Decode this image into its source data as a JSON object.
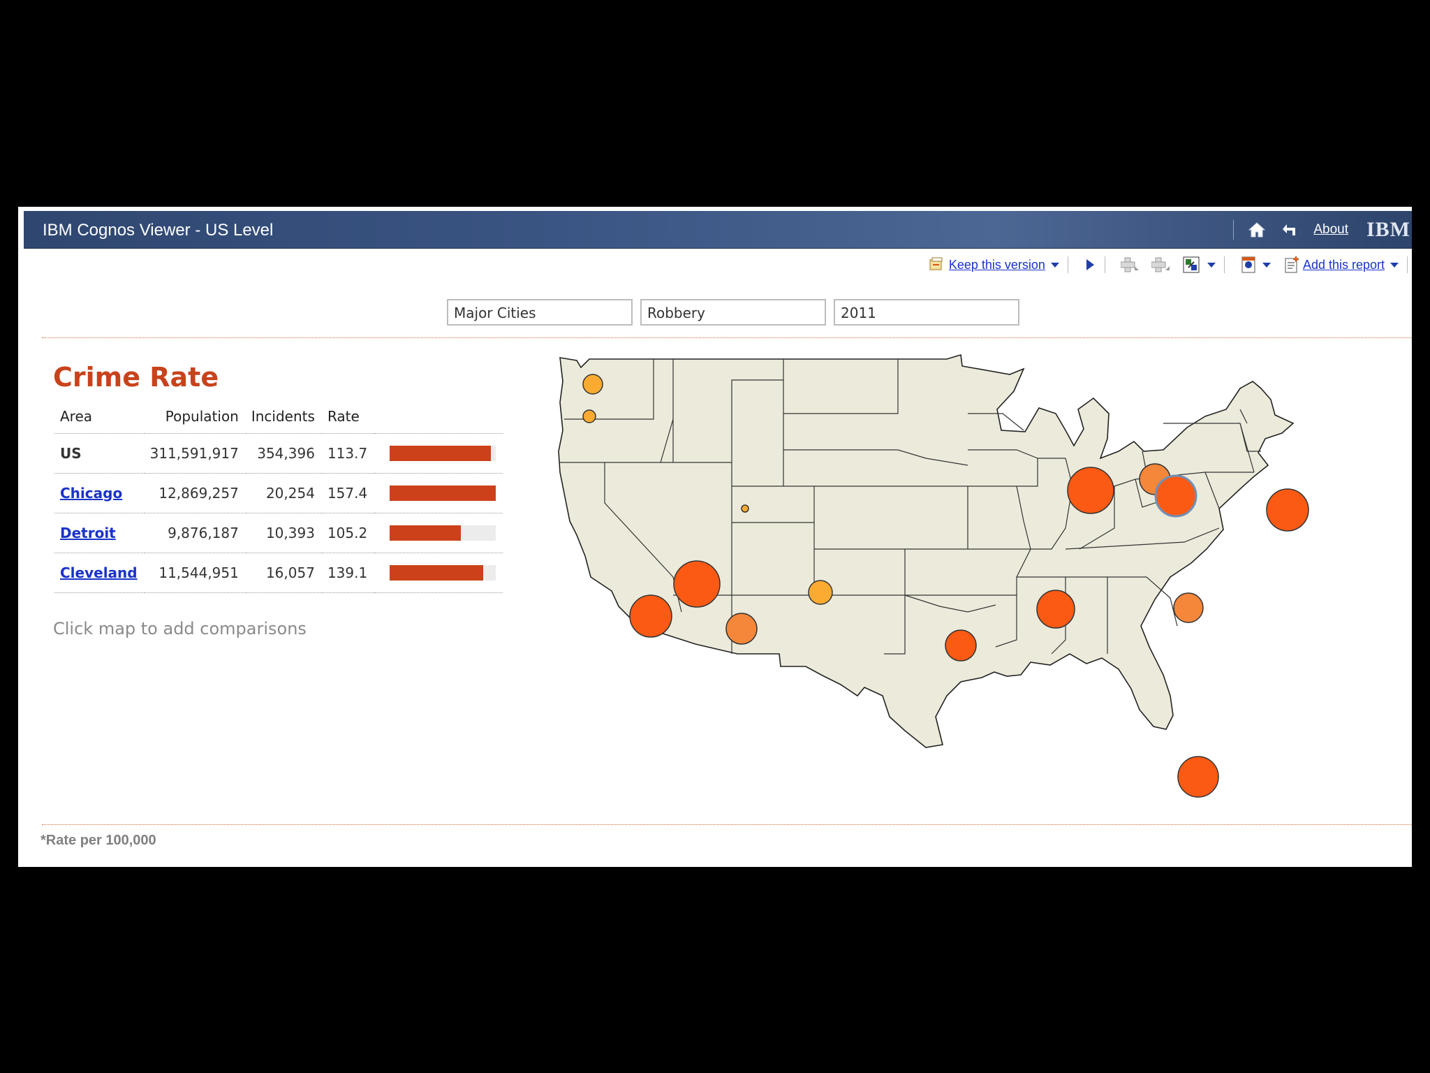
{
  "window": {
    "title": "IBM Cognos Viewer - US Level",
    "about_label": "About",
    "brand": "IBM"
  },
  "toolbar": {
    "keep_version_label": "Keep this version",
    "add_report_label": "Add this report"
  },
  "prompts": {
    "area": "Major Cities",
    "crime": "Robbery",
    "year": "2011"
  },
  "report": {
    "title": "Crime Rate",
    "columns": [
      "Area",
      "Population",
      "Incidents",
      "Rate"
    ],
    "rows": [
      {
        "area": "US",
        "population": "311,591,917",
        "incidents": "354,396",
        "rate": "113.7",
        "bar_fraction": 0.95,
        "link": false
      },
      {
        "area": "Chicago",
        "population": "12,869,257",
        "incidents": "20,254",
        "rate": "157.4",
        "bar_fraction": 1.0,
        "link": true
      },
      {
        "area": "Detroit",
        "population": "9,876,187",
        "incidents": "10,393",
        "rate": "105.2",
        "bar_fraction": 0.67,
        "link": true
      },
      {
        "area": "Cleveland",
        "population": "11,544,951",
        "incidents": "16,057",
        "rate": "139.1",
        "bar_fraction": 0.88,
        "link": true
      }
    ],
    "hint": "Click map to add comparisons",
    "footnote": "*Rate per 100,000"
  },
  "colors": {
    "accent": "#c8431c",
    "bar": "#cc4119",
    "link": "#1a33c8",
    "map_land": "#ecebdb",
    "bubble_high": "#fa5a14",
    "bubble_mid": "#f4873a",
    "bubble_low": "#fbab32"
  },
  "icons": [
    "home-icon",
    "back-arrow-icon",
    "keep-version-icon",
    "run-icon",
    "drill-down-icon",
    "drill-up-icon",
    "related-links-icon",
    "view-in-format-icon",
    "add-report-icon"
  ]
}
